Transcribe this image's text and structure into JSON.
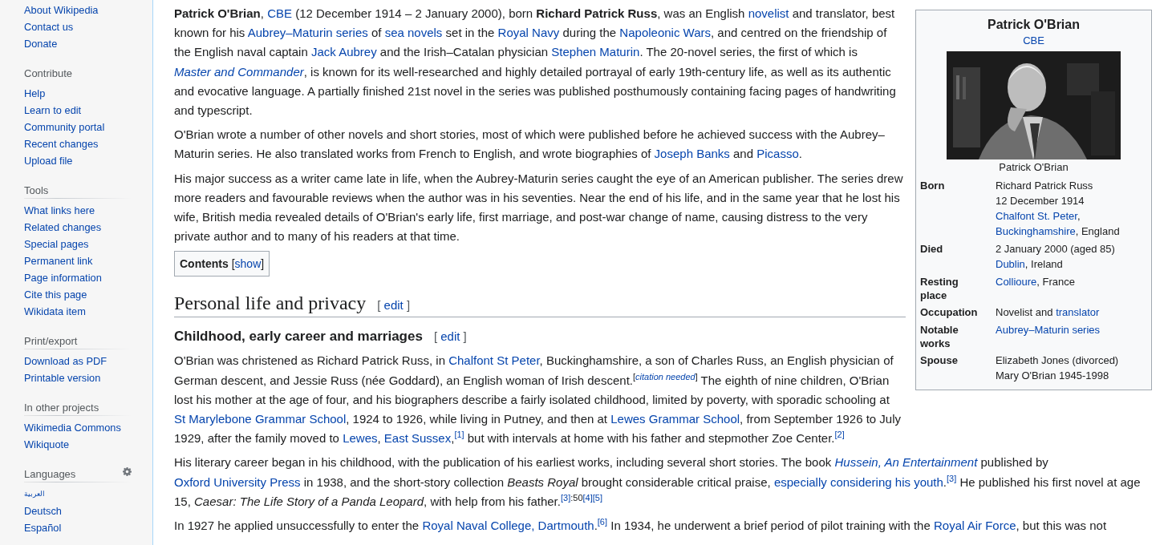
{
  "sidebar": {
    "sections": [
      {
        "items": [
          "About Wikipedia",
          "Contact us",
          "Donate"
        ]
      },
      {
        "header": "Contribute",
        "divider": false,
        "items": [
          "Help",
          "Learn to edit",
          "Community portal",
          "Recent changes",
          "Upload file"
        ]
      },
      {
        "header": "Tools",
        "divider": true,
        "items": [
          "What links here",
          "Related changes",
          "Special pages",
          "Permanent link",
          "Page information",
          "Cite this page",
          "Wikidata item"
        ]
      },
      {
        "header": "Print/export",
        "divider": true,
        "items": [
          "Download as PDF",
          "Printable version"
        ]
      },
      {
        "header": "In other projects",
        "divider": true,
        "items": [
          "Wikimedia Commons",
          "Wikiquote"
        ]
      },
      {
        "header": "Languages",
        "divider": true,
        "settings": true,
        "items": [
          "العربية",
          "Deutsch",
          "Español"
        ]
      }
    ]
  },
  "infobox": {
    "title": "Patrick O'Brian",
    "subtitle": "CBE",
    "caption": "Patrick O'Brian",
    "rows": [
      {
        "label": "Born",
        "value": [
          [
            {
              "kind": "text",
              "text": "Richard Patrick Russ"
            }
          ],
          [
            {
              "kind": "text",
              "text": "12 December 1914"
            }
          ],
          [
            {
              "kind": "link",
              "text": "Chalfont St. Peter"
            },
            {
              "kind": "text",
              "text": ","
            }
          ],
          [
            {
              "kind": "link",
              "text": "Buckinghamshire"
            },
            {
              "kind": "text",
              "text": ", England"
            }
          ]
        ]
      },
      {
        "label": "Died",
        "value": [
          [
            {
              "kind": "text",
              "text": "2 January 2000 (aged 85)"
            }
          ],
          [
            {
              "kind": "link",
              "text": "Dublin"
            },
            {
              "kind": "text",
              "text": ", Ireland"
            }
          ]
        ]
      },
      {
        "label": "Resting place",
        "value": [
          [
            {
              "kind": "link",
              "text": "Collioure"
            },
            {
              "kind": "text",
              "text": ", France"
            }
          ]
        ]
      },
      {
        "label": "Occupation",
        "value": [
          [
            {
              "kind": "text",
              "text": "Novelist and "
            },
            {
              "kind": "link",
              "text": "translator"
            }
          ]
        ]
      },
      {
        "label": "Notable works",
        "value": [
          [
            {
              "kind": "link",
              "text": "Aubrey–Maturin series"
            }
          ]
        ]
      },
      {
        "label": "Spouse",
        "value": [
          [
            {
              "kind": "text",
              "text": "Elizabeth Jones (divorced)"
            }
          ],
          [
            {
              "kind": "text",
              "text": "Mary O'Brian 1945-1998"
            }
          ]
        ]
      }
    ]
  },
  "intro": [
    [
      {
        "kind": "text",
        "text": "**Patrick O'Brian**, "
      },
      {
        "kind": "link",
        "text": "CBE"
      },
      {
        "kind": "text",
        "text": " (12 December 1914 – 2 January 2000), born **Richard Patrick Russ**, was an English "
      },
      {
        "kind": "link",
        "text": "novelist"
      },
      {
        "kind": "text",
        "text": " and translator, best known for his "
      },
      {
        "kind": "link",
        "text": "Aubrey–Maturin series"
      },
      {
        "kind": "text",
        "text": " of "
      },
      {
        "kind": "link",
        "text": "sea novels"
      },
      {
        "kind": "text",
        "text": " set in the "
      },
      {
        "kind": "link",
        "text": "Royal Navy"
      },
      {
        "kind": "text",
        "text": " during the "
      },
      {
        "kind": "link",
        "text": "Napoleonic Wars"
      },
      {
        "kind": "text",
        "text": ", and centred on the friendship of the English naval captain "
      },
      {
        "kind": "link",
        "text": "Jack Aubrey"
      },
      {
        "kind": "text",
        "text": " and the Irish–Catalan physician "
      },
      {
        "kind": "link",
        "text": "Stephen Maturin"
      },
      {
        "kind": "text",
        "text": ". The 20-novel series, the first of which is "
      },
      {
        "kind": "link",
        "text": "*Master and Commander*"
      },
      {
        "kind": "text",
        "text": ", is known for its well-researched and highly detailed portrayal of early 19th-century life, as well as its authentic and evocative language. A partially finished 21st novel in the series was published posthumously containing facing pages of handwriting and typescript."
      }
    ],
    [
      {
        "kind": "text",
        "text": "O'Brian wrote a number of other novels and short stories, most of which were published before he achieved success with the Aubrey–Maturin series. He also translated works from French to English, and wrote biographies of "
      },
      {
        "kind": "link",
        "text": "Joseph Banks"
      },
      {
        "kind": "text",
        "text": " and "
      },
      {
        "kind": "link",
        "text": "Picasso"
      },
      {
        "kind": "text",
        "text": "."
      }
    ],
    [
      {
        "kind": "text",
        "text": "His major success as a writer came late in life, when the Aubrey-Maturin series caught the eye of an American publisher. The series drew more readers and favourable reviews when the author was in his seventies. Near the end of his life, and in the same year that he lost his wife, British media revealed details of O'Brian's early life, first marriage, and post-war change of name, causing distress to the very private author and to many of his readers at that time."
      }
    ]
  ],
  "toc": {
    "title": "Contents",
    "open_bracket": "[",
    "toggle": "show",
    "close_bracket": "]"
  },
  "section": {
    "title": "Personal life and privacy",
    "edit": {
      "open": "[",
      "label": "edit",
      "close": "]"
    }
  },
  "subsection": {
    "title": "Childhood, early career and marriages",
    "edit": {
      "open": "[",
      "label": "edit",
      "close": "]"
    }
  },
  "body": [
    [
      {
        "kind": "text",
        "text": "O'Brian was christened as Richard Patrick Russ, in "
      },
      {
        "kind": "link",
        "text": "Chalfont St Peter"
      },
      {
        "kind": "text",
        "text": ", Buckinghamshire, a son of Charles Russ, an English physician of German descent, and Jessie Russ (née Goddard), an English woman of Irish descent."
      },
      {
        "kind": "sup",
        "text": "["
      },
      {
        "kind": "ref",
        "text": "*citation needed*"
      },
      {
        "kind": "sup",
        "text": "]"
      },
      {
        "kind": "text",
        "text": " The eighth of nine children, O'Brian lost his mother at the age of four, and his biographers describe a fairly isolated childhood, limited by poverty, with sporadic schooling at "
      },
      {
        "kind": "link",
        "text": "St Marylebone Grammar School"
      },
      {
        "kind": "text",
        "text": ", 1924 to 1926, while living in Putney, and then at "
      },
      {
        "kind": "link",
        "text": "Lewes Grammar School"
      },
      {
        "kind": "text",
        "text": ", from September 1926 to July 1929, after the family moved to "
      },
      {
        "kind": "link",
        "text": "Lewes"
      },
      {
        "kind": "text",
        "text": ", "
      },
      {
        "kind": "link",
        "text": "East Sussex"
      },
      {
        "kind": "text",
        "text": ","
      },
      {
        "kind": "ref",
        "text": "[1]"
      },
      {
        "kind": "text",
        "text": " but with intervals at home with his father and stepmother Zoe Center."
      },
      {
        "kind": "ref",
        "text": "[2]"
      }
    ],
    [
      {
        "kind": "text",
        "text": "His literary career began in his childhood, with the publication of his earliest works, including several short stories. The book "
      },
      {
        "kind": "link",
        "text": "*Hussein, An Entertainment*"
      },
      {
        "kind": "text",
        "text": " published by "
      },
      {
        "kind": "link",
        "text": "Oxford University Press"
      },
      {
        "kind": "text",
        "text": " in 1938, and the short-story collection *Beasts Royal* brought considerable critical praise, "
      },
      {
        "kind": "link",
        "text": "especially considering his youth"
      },
      {
        "kind": "text",
        "text": "."
      },
      {
        "kind": "ref",
        "text": "[3]"
      },
      {
        "kind": "text",
        "text": " He published his first novel at age 15, *Caesar: The Life Story of a Panda Leopard*, with help from his father."
      },
      {
        "kind": "ref",
        "text": "[3]"
      },
      {
        "kind": "sup",
        "text": ":50"
      },
      {
        "kind": "ref",
        "text": "[4]"
      },
      {
        "kind": "ref",
        "text": "[5]"
      }
    ],
    [
      {
        "kind": "text",
        "text": "In 1927 he applied unsuccessfully to enter the "
      },
      {
        "kind": "link",
        "text": "Royal Naval College, Dartmouth"
      },
      {
        "kind": "text",
        "text": ".$^{[6]}$ In 1934, he underwent a brief period of pilot training with the "
      },
      {
        "kind": "link",
        "text": "Royal Air Force"
      },
      {
        "kind": "text",
        "text": ", but this was not"
      }
    ]
  ]
}
